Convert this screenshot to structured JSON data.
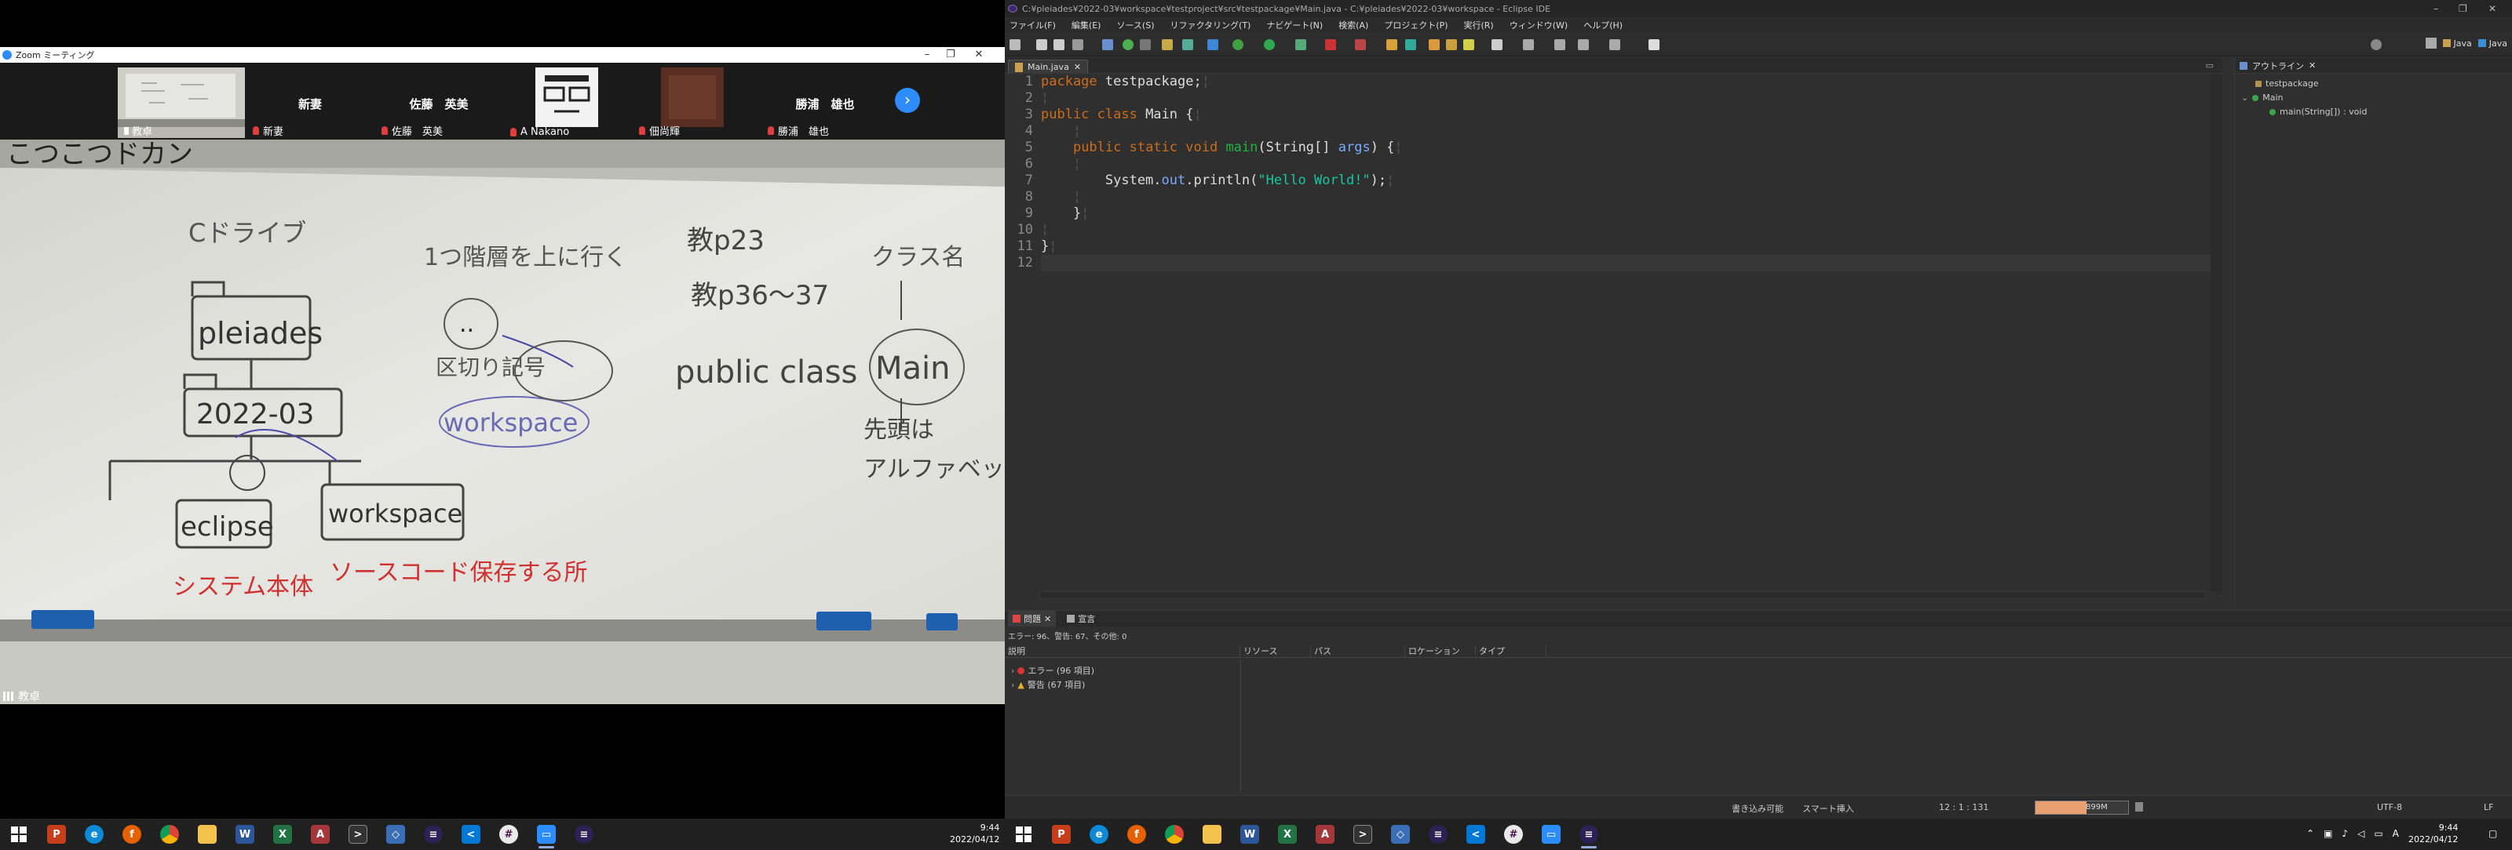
{
  "zoom": {
    "window_title": "Zoom ミーティング",
    "participants": [
      {
        "name": "教卓",
        "label": "教卓",
        "muted": false,
        "has_video": true
      },
      {
        "name": "新妻",
        "label": "新妻",
        "muted": true,
        "has_video": false
      },
      {
        "name": "佐藤　英美",
        "label": "佐藤　英美",
        "muted": true,
        "has_video": false
      },
      {
        "name": "A Nakano",
        "label": "A Nakano",
        "muted": true,
        "has_video": true
      },
      {
        "name": "佃尚輝",
        "label": "佃尚輝",
        "muted": true,
        "has_video": true
      },
      {
        "name": "勝浦　雄也",
        "label": "勝浦　雄也",
        "muted": true,
        "has_video": false
      }
    ],
    "speaker_label": "教卓",
    "whiteboard": {
      "banner": "こつこつドカン",
      "c_drive": "Cドライブ",
      "folder1": "pleiades",
      "folder2": "2022-03",
      "folder3": "eclipse",
      "folder4": "workspace",
      "note_eclipse": "システム本体",
      "note_workspace": "ソースコード保存する所",
      "up_one": "1つ階層を上に行く",
      "dots": "..",
      "separator": "区切り記号",
      "workspace_circle": "workspace",
      "ref1": "教p23",
      "ref2": "教p36～37",
      "class_name_note": "クラス名",
      "public_class": "public class",
      "main_circled": "Main",
      "first_letter": "先頭は",
      "capital": "アルファベット大文字"
    }
  },
  "taskbar_left": {
    "time": "9:44",
    "date": "2022/04/12"
  },
  "eclipse": {
    "window_title": "C:¥pleiades¥2022-03¥workspace¥testproject¥src¥testpackage¥Main.java - C:¥pleiades¥2022-03¥workspace - Eclipse IDE",
    "menu": [
      "ファイル(F)",
      "編集(E)",
      "ソース(S)",
      "リファクタリング(T)",
      "ナビゲート(N)",
      "検索(A)",
      "プロジェクト(P)",
      "実行(R)",
      "ウィンドウ(W)",
      "ヘルプ(H)"
    ],
    "perspective": "Java",
    "editor_tab": "Main.java",
    "code_lines": [
      {
        "n": "1",
        "html": "<span class='kw'>package</span> testpackage;<span class='ws'>¦</span>"
      },
      {
        "n": "2",
        "html": "<span class='ws'>¦</span>"
      },
      {
        "n": "3",
        "html": "<span class='kw'>public class</span> Main {<span class='ws'>¦</span>"
      },
      {
        "n": "4",
        "html": "<span class='ws'>    ¦</span>"
      },
      {
        "n": "5",
        "html": "    <span class='kw'>public static void</span> <span class='mth'>main</span>(String[] <span class='var'>args</span>) {<span class='ws'>¦</span>"
      },
      {
        "n": "6",
        "html": "<span class='ws'>    ¦</span>"
      },
      {
        "n": "7",
        "html": "        System.<span class='var'>out</span>.println(<span class='str'>\"Hello World!\"</span>);<span class='ws'>¦</span>"
      },
      {
        "n": "8",
        "html": "<span class='ws'>    ¦</span>"
      },
      {
        "n": "9",
        "html": "    }<span class='ws'>¦</span>"
      },
      {
        "n": "10",
        "html": "<span class='ws'>¦</span>"
      },
      {
        "n": "11",
        "html": "}<span class='ws'>¦</span>"
      },
      {
        "n": "12",
        "html": ""
      }
    ],
    "outline": {
      "title": "アウトライン",
      "package": "testpackage",
      "class": "Main",
      "method": "main(String[]) : void"
    },
    "problems": {
      "tab_problems": "問題",
      "tab_declaration": "宣言",
      "summary": "エラー: 96、警告: 67、その他: 0",
      "col_description": "説明",
      "col_resource": "リソース",
      "col_path": "パス",
      "col_location": "ロケーション",
      "col_type": "タイプ",
      "errors": "エラー (96 項目)",
      "warnings": "警告 (67 項目)"
    },
    "status": {
      "writable": "書き込み可能",
      "insert": "スマート挿入",
      "position": "12 : 1 : 131",
      "heap_used": "899M",
      "heap_fraction": 0.55,
      "encoding": "UTF-8",
      "line_ending": "LF"
    }
  },
  "taskbar_right": {
    "time": "9:44",
    "date": "2022/04/12"
  }
}
